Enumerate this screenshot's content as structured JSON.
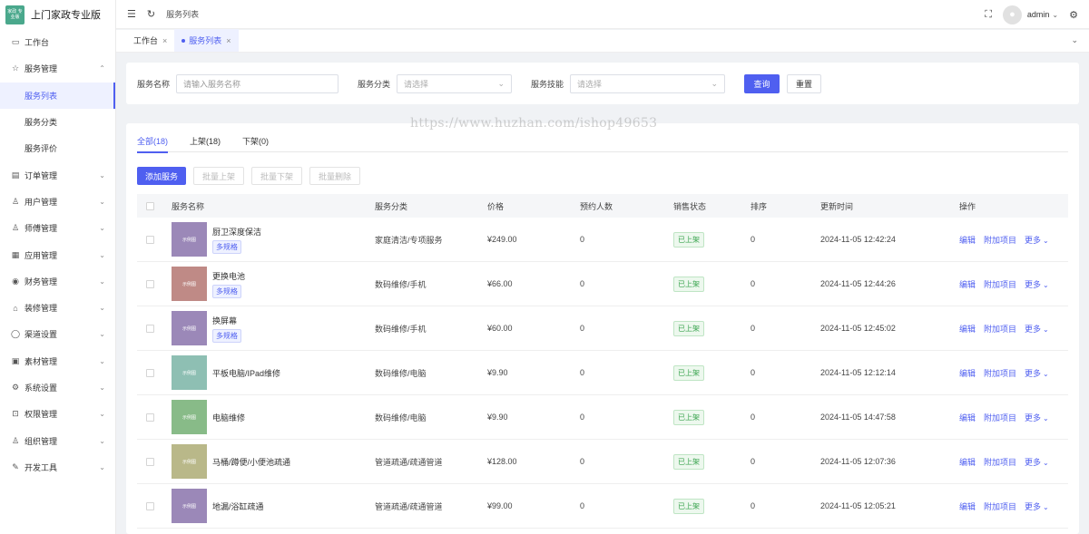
{
  "app": {
    "logo_text": "家政 专业版",
    "title": "上门家政专业版"
  },
  "sidebar": {
    "items": [
      {
        "label": "工作台",
        "icon": "monitor-icon",
        "glyph": "▭",
        "arrow": ""
      },
      {
        "label": "服务管理",
        "icon": "star-icon",
        "glyph": "☆",
        "arrow": "⌃"
      },
      {
        "label": "订单管理",
        "icon": "document-icon",
        "glyph": "▤",
        "arrow": "⌄"
      },
      {
        "label": "用户管理",
        "icon": "user-icon",
        "glyph": "♙",
        "arrow": "⌄"
      },
      {
        "label": "师傅管理",
        "icon": "worker-icon",
        "glyph": "♙",
        "arrow": "⌄"
      },
      {
        "label": "应用管理",
        "icon": "apps-icon",
        "glyph": "▦",
        "arrow": "⌄"
      },
      {
        "label": "财务管理",
        "icon": "finance-icon",
        "glyph": "◉",
        "arrow": "⌄"
      },
      {
        "label": "装修管理",
        "icon": "decoration-icon",
        "glyph": "⌂",
        "arrow": "⌄"
      },
      {
        "label": "渠道设置",
        "icon": "chat-icon",
        "glyph": "◯",
        "arrow": "⌄"
      },
      {
        "label": "素材管理",
        "icon": "image-icon",
        "glyph": "▣",
        "arrow": "⌄"
      },
      {
        "label": "系统设置",
        "icon": "gear-icon",
        "glyph": "⚙",
        "arrow": "⌄"
      },
      {
        "label": "权限管理",
        "icon": "lock-icon",
        "glyph": "⊡",
        "arrow": "⌄"
      },
      {
        "label": "组织管理",
        "icon": "org-icon",
        "glyph": "♙",
        "arrow": "⌄"
      },
      {
        "label": "开发工具",
        "icon": "pen-icon",
        "glyph": "✎",
        "arrow": "⌄"
      }
    ],
    "submenu": [
      {
        "label": "服务列表",
        "active": true
      },
      {
        "label": "服务分类",
        "active": false
      },
      {
        "label": "服务评价",
        "active": false
      }
    ]
  },
  "topbar": {
    "breadcrumb": "服务列表",
    "user": "admin"
  },
  "tabs": [
    {
      "label": "工作台",
      "active": false
    },
    {
      "label": "服务列表",
      "active": true
    }
  ],
  "filters": {
    "name_label": "服务名称",
    "name_placeholder": "请输入服务名称",
    "category_label": "服务分类",
    "category_placeholder": "请选择",
    "skill_label": "服务技能",
    "skill_placeholder": "请选择",
    "search_button": "查询",
    "reset_button": "重置"
  },
  "watermark": "https://www.huzhan.com/ishop49653",
  "status_tabs": [
    {
      "label": "全部(18)",
      "active": true
    },
    {
      "label": "上架(18)",
      "active": false
    },
    {
      "label": "下架(0)",
      "active": false
    }
  ],
  "actions": {
    "add": "添加服务",
    "batch_on": "批量上架",
    "batch_off": "批量下架",
    "batch_delete": "批量删除"
  },
  "table": {
    "columns": [
      "服务名称",
      "服务分类",
      "价格",
      "预约人数",
      "销售状态",
      "排序",
      "更新时间",
      "操作"
    ],
    "thumb_text": "示例图",
    "tag_spec": "多规格",
    "ops": {
      "edit": "编辑",
      "addon": "附加项目",
      "more": "更多"
    },
    "rows": [
      {
        "name": "厨卫深度保洁",
        "multi": true,
        "category": "家庭清洁/专项服务",
        "price": "¥249.00",
        "bookings": "0",
        "status": "已上架",
        "sort": "0",
        "updated": "2024-11-05 12:42:24",
        "color": "#9b88b8"
      },
      {
        "name": "更换电池",
        "multi": true,
        "category": "数码维修/手机",
        "price": "¥66.00",
        "bookings": "0",
        "status": "已上架",
        "sort": "0",
        "updated": "2024-11-05 12:44:26",
        "color": "#bf8a86"
      },
      {
        "name": "换屏幕",
        "multi": true,
        "category": "数码维修/手机",
        "price": "¥60.00",
        "bookings": "0",
        "status": "已上架",
        "sort": "0",
        "updated": "2024-11-05 12:45:02",
        "color": "#9b88b8"
      },
      {
        "name": "平板电脑/IPad维修",
        "multi": false,
        "category": "数码维修/电脑",
        "price": "¥9.90",
        "bookings": "0",
        "status": "已上架",
        "sort": "0",
        "updated": "2024-11-05 12:12:14",
        "color": "#8ebfb3"
      },
      {
        "name": "电脑维修",
        "multi": false,
        "category": "数码维修/电脑",
        "price": "¥9.90",
        "bookings": "0",
        "status": "已上架",
        "sort": "0",
        "updated": "2024-11-05 14:47:58",
        "color": "#88bb88"
      },
      {
        "name": "马桶/蹲便/小便池疏通",
        "multi": false,
        "category": "管道疏通/疏通管道",
        "price": "¥128.00",
        "bookings": "0",
        "status": "已上架",
        "sort": "0",
        "updated": "2024-11-05 12:07:36",
        "color": "#b9b889"
      },
      {
        "name": "地漏/浴缸疏通",
        "multi": false,
        "category": "管道疏通/疏通管道",
        "price": "¥99.00",
        "bookings": "0",
        "status": "已上架",
        "sort": "0",
        "updated": "2024-11-05 12:05:21",
        "color": "#9b88b8"
      }
    ]
  },
  "colors": {
    "primary": "#4f5ff0",
    "success": "#3aa44f"
  }
}
